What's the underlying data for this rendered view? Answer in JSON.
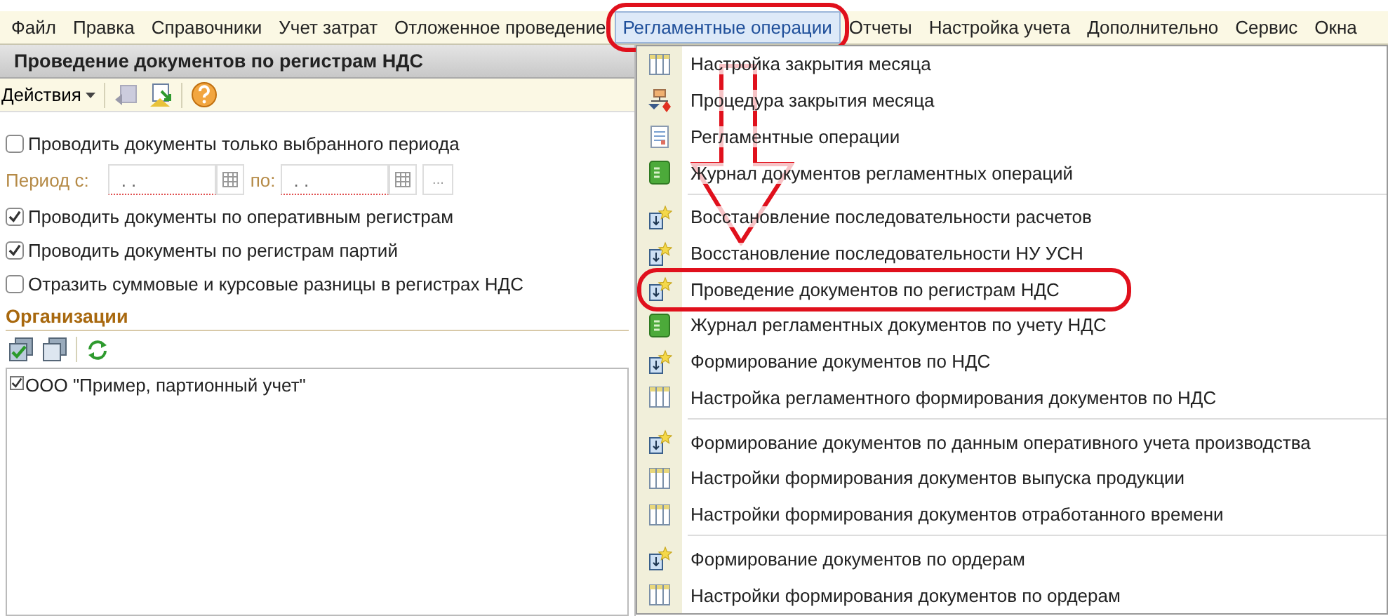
{
  "menubar": [
    {
      "label": "Файл",
      "selected": false,
      "circled": false
    },
    {
      "label": "Правка",
      "selected": false,
      "circled": false
    },
    {
      "label": "Справочники",
      "selected": false,
      "circled": false
    },
    {
      "label": "Учет затрат",
      "selected": false,
      "circled": false
    },
    {
      "label": "Отложенное проведение",
      "selected": false,
      "circled": false
    },
    {
      "label": "Регламентные операции",
      "selected": true,
      "circled": true
    },
    {
      "label": "Отчеты",
      "selected": false,
      "circled": false
    },
    {
      "label": "Настройка учета",
      "selected": false,
      "circled": false
    },
    {
      "label": "Дополнительно",
      "selected": false,
      "circled": false
    },
    {
      "label": "Сервис",
      "selected": false,
      "circled": false
    },
    {
      "label": "Окна",
      "selected": false,
      "circled": false
    }
  ],
  "form": {
    "title": "Проведение документов по регистрам НДС",
    "toolbar": {
      "actions": "Действия"
    },
    "options": [
      {
        "label": "Проводить документы только выбранного периода",
        "checked": false
      }
    ],
    "period": {
      "from_label": "Период с:",
      "from_value": ". .",
      "to_label": "по:",
      "to_value": ". .",
      "more": "..."
    },
    "options2": [
      {
        "label": "Проводить документы по оперативным регистрам",
        "checked": true
      },
      {
        "label": "Проводить документы по регистрам партий",
        "checked": true
      },
      {
        "label": "Отразить суммовые и курсовые разницы в регистрах НДС",
        "checked": false
      }
    ],
    "organizations": {
      "title": "Организации",
      "rows": [
        {
          "label": "ООО \"Пример, партионный учет\"",
          "checked": true
        }
      ]
    }
  },
  "dropdown": {
    "arrow": true,
    "groups": [
      [
        {
          "label": "Настройка закрытия месяца",
          "kind": "table",
          "circled": false
        },
        {
          "label": "Процедура закрытия месяца",
          "kind": "procedure",
          "circled": false
        },
        {
          "label": "Регламентные операции",
          "kind": "report",
          "circled": false
        },
        {
          "label": "Журнал документов регламентных операций",
          "kind": "journal",
          "circled": false
        }
      ],
      [
        {
          "label": "Восстановление последовательности расчетов",
          "kind": "process",
          "circled": false
        },
        {
          "label": "Восстановление последовательности НУ УСН",
          "kind": "process",
          "circled": false
        },
        {
          "label": "Проведение документов по регистрам НДС",
          "kind": "process",
          "circled": true
        },
        {
          "label": "Журнал регламентных документов по учету НДС",
          "kind": "journal",
          "circled": false
        },
        {
          "label": "Формирование документов по НДС",
          "kind": "process",
          "circled": false
        },
        {
          "label": "Настройка регламентного формирования документов по НДС",
          "kind": "table",
          "circled": false
        }
      ],
      [
        {
          "label": "Формирование документов по данным оперативного учета производства",
          "kind": "process",
          "circled": false
        },
        {
          "label": "Настройки формирования документов выпуска продукции",
          "kind": "table",
          "circled": false
        },
        {
          "label": "Настройки формирования документов отработанного времени",
          "kind": "table",
          "circled": false
        }
      ],
      [
        {
          "label": "Формирование документов по ордерам",
          "kind": "process",
          "circled": false
        },
        {
          "label": "Настройки формирования документов по ордерам",
          "kind": "table",
          "circled": false
        }
      ]
    ]
  }
}
